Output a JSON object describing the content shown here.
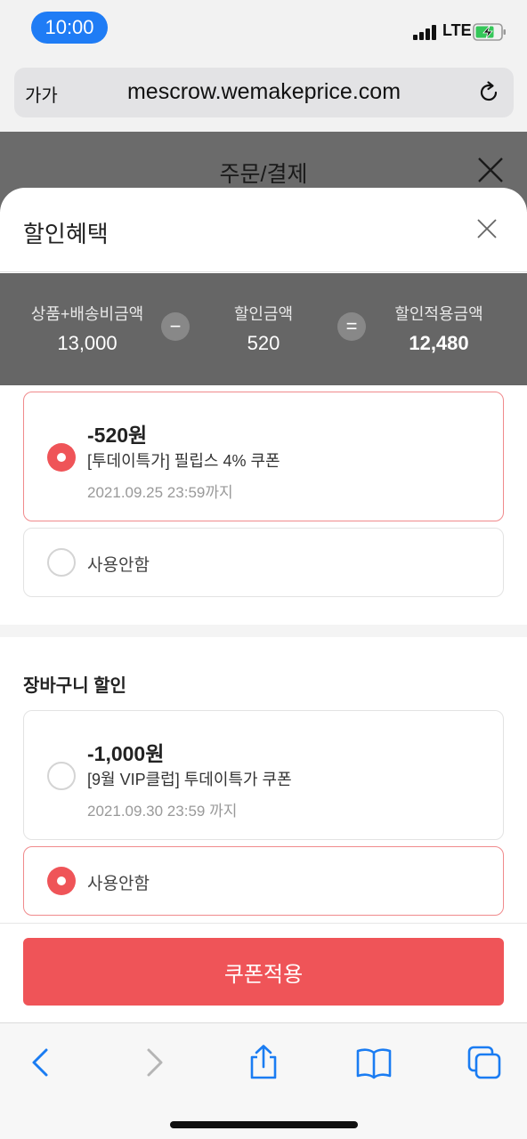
{
  "status_bar": {
    "time": "10:00",
    "network": "LTE"
  },
  "browser": {
    "aa_label": "가가",
    "url": "mescrow.wemakeprice.com"
  },
  "page_header": {
    "title": "주문/결제"
  },
  "sheet": {
    "title": "할인혜택",
    "summary": {
      "items": [
        {
          "label": "상품+배송비금액",
          "value": "13,000"
        },
        {
          "label": "할인금액",
          "value": "520"
        },
        {
          "label": "할인적용금액",
          "value": "12,480"
        }
      ],
      "minus_symbol": "−",
      "equals_symbol": "="
    },
    "product_coupons": {
      "options": [
        {
          "amount": "-520원",
          "name": "[투데이특가] 필립스 4% 쿠폰",
          "date": "2021.09.25 23:59까지",
          "selected": true
        },
        {
          "label": "사용안함",
          "selected": false
        }
      ]
    },
    "cart_coupons": {
      "title": "장바구니 할인",
      "options": [
        {
          "amount": "-1,000원",
          "name": "[9월 VIP클럽] 투데이특가 쿠폰",
          "date": "2021.09.30 23:59 까지",
          "selected": false
        },
        {
          "label": "사용안함",
          "selected": true
        }
      ]
    },
    "apply_label": "쿠폰적용"
  },
  "colors": {
    "accent": "#ef5458",
    "summary_bg": "#666666",
    "time_pill": "#1f7cf5",
    "ios_blue": "#1a7cf2"
  },
  "icons": [
    "close-icon",
    "reload-icon",
    "back-icon",
    "forward-icon",
    "share-icon",
    "bookmarks-icon",
    "tabs-icon",
    "battery-charging-icon",
    "signal-icon"
  ]
}
